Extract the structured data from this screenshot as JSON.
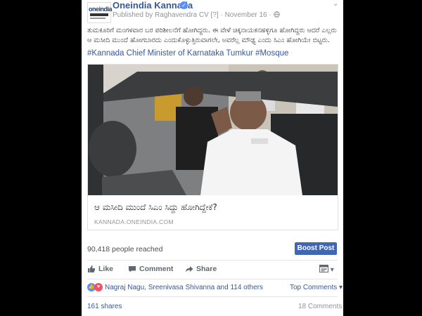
{
  "post": {
    "page_name": "Oneindia Kannada",
    "publisher_prefix": "Published by Raghavendra CV",
    "publisher_suffix": "[?]",
    "date": "November 16",
    "body_text": "ತುಮಕೂರಿಗೆ ಮಂಗಳವಾರ ಬರ ಪರಿಶೀಲನೆಗೆ ಹೋಗಿದ್ದರು. ಈ ವೇಳೆ ಚಿಕ್ಕನಾಯಕನಹಳ್ಳಿಗೂ ಹೋಗಿದ್ದರು ಆದರೆ ಎಲ್ಲರು ಆ ಮಸೀದಿ ಮುಂದೆ ಹೋಗಬಾರದು ಎಂದುಕೊಳ್ಳುತ್ತಿರುವಾಗಲೇ, ಅವರೆಲ್ಲ ಮೌಢ್ಯ ಎಂದು ಸಿಎಂ ಹೋಗಿಯೇ ಬಿಟ್ಟರು.",
    "hashtags": "#Kannada Chief Minister of Karnataka Tumkur #Mosque"
  },
  "link": {
    "title": "ಆ ಮಸೀದಿ ಮುಂದೆ ಸಿಎಂ ಸಿದ್ದು ಹೋಗಿದ್ದೇಕೆ?",
    "domain": "KANNADA.ONEINDIA.COM"
  },
  "stats": {
    "reached": "90,418 people reached",
    "boost_label": "Boost Post"
  },
  "actions": {
    "like": "Like",
    "comment": "Comment",
    "share": "Share"
  },
  "reactions": {
    "names": "Nagraj Nagu, Sreenivasa Shivanna and 114 others",
    "top_comments": "Top Comments"
  },
  "footer": {
    "shares": "161 shares",
    "comments": "18 Comments"
  },
  "colors": {
    "link_blue": "#365899",
    "boost_blue": "#4267b2",
    "like_blue": "#5890ff",
    "love_red": "#f25268"
  },
  "icons": [
    "verified-badge-icon",
    "globe-icon",
    "chevron-down-icon",
    "thumbs-up-icon",
    "comment-icon",
    "share-icon",
    "heart-icon"
  ]
}
